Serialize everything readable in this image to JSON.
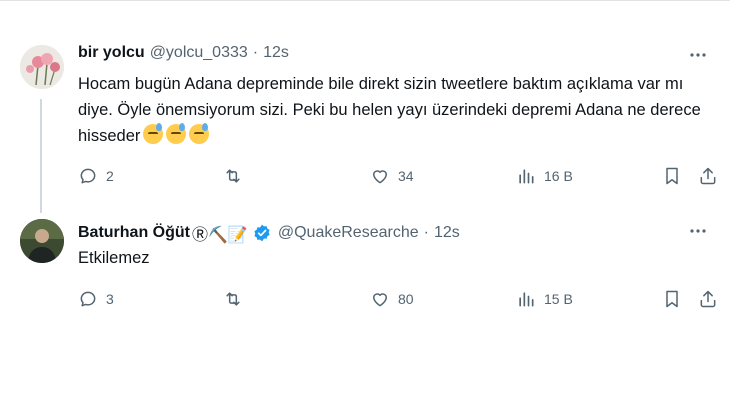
{
  "tweets": [
    {
      "display_name": "bir yolcu",
      "handle": "@yolcu_0333",
      "sep": "·",
      "time": "12s",
      "text": "Hocam bugün Adana depreminde bile direkt sizin tweetlere baktım açıklama var mı diye. Öyle önemsiyorum sizi. Peki bu helen yayı üzerindeki depremi Adana ne derece hisseder",
      "emojis": [
        "downcast-sweat-emoji",
        "downcast-sweat-emoji",
        "downcast-sweat-emoji"
      ],
      "replies": "2",
      "retweets": "",
      "likes": "34",
      "views": "16 B"
    },
    {
      "display_name": "Baturhan Öğüt",
      "name_suffix": "Ⓡ⛏️📝",
      "handle": "@QuakeResearche",
      "sep": "·",
      "time": "12s",
      "text": "Etkilemez",
      "replies": "3",
      "retweets": "",
      "likes": "80",
      "views": "15 B"
    }
  ],
  "colors": {
    "text": "#0f1419",
    "muted": "#536471",
    "verified": "#1d9bf0",
    "thread": "#cfd9de"
  },
  "icons": [
    "reply-icon",
    "retweet-icon",
    "like-icon",
    "views-icon",
    "bookmark-icon",
    "share-icon",
    "more-icon",
    "verified-badge-icon"
  ]
}
